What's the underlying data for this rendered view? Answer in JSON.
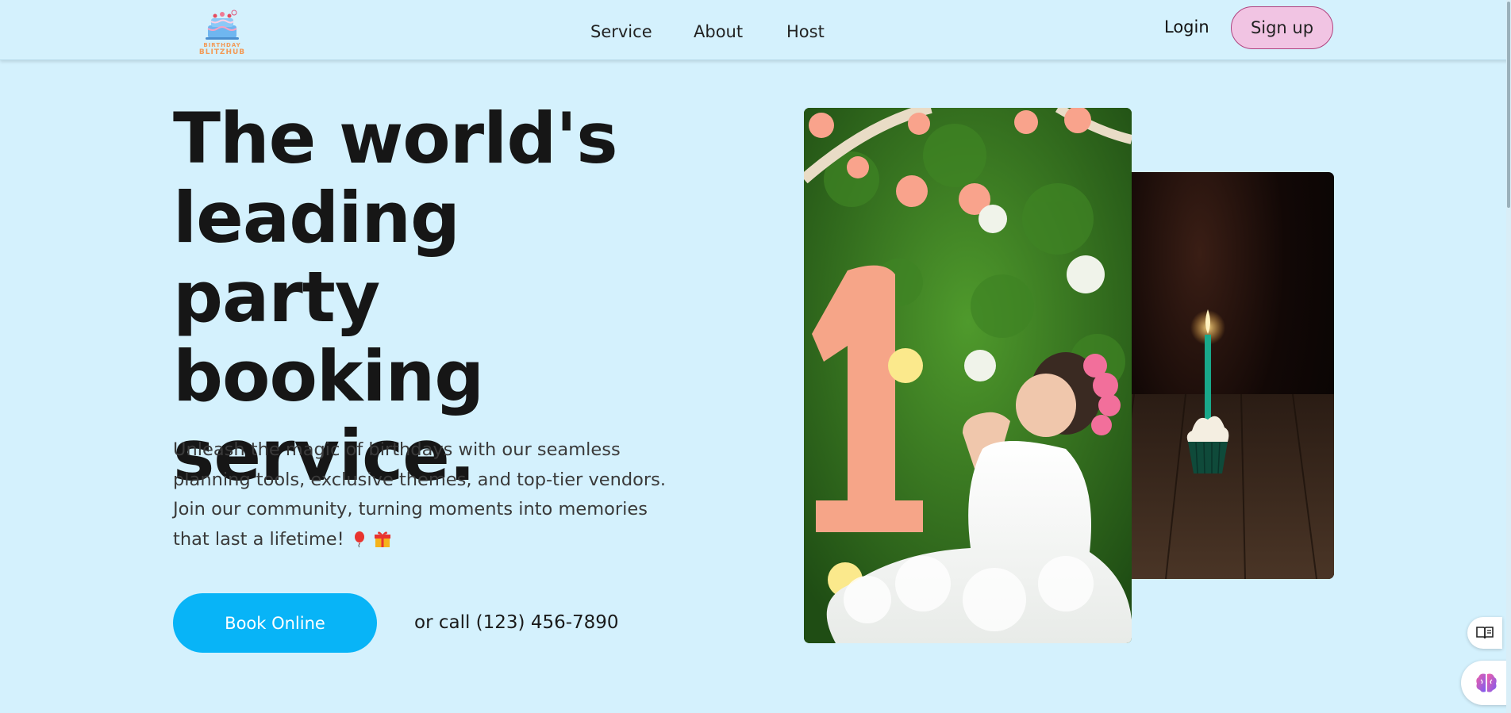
{
  "header": {
    "logo": {
      "line1": "BIRTHDAY",
      "line2": "BLITZHUB"
    },
    "nav": [
      "Service",
      "About",
      "Host"
    ],
    "login_label": "Login",
    "signup_label": "Sign up"
  },
  "hero": {
    "headline": "The world's\nleading party\nbooking\nservice.",
    "subtext": "Unleash the magic of birthdays with our seamless planning tools, exclusive themes, and top-tier vendors. Join our community, turning moments into memories that last a lifetime!",
    "book_button_label": "Book Online",
    "call_text": "or call (123) 456-7890"
  },
  "colors": {
    "background": "#d4f1fd",
    "primary_button": "#08b4f7",
    "signup_button": "#f1c4e3",
    "signup_border": "#b0427f"
  },
  "icons": [
    "balloon-emoji-icon",
    "gift-emoji-icon",
    "reader-mode-icon",
    "brain-icon"
  ]
}
